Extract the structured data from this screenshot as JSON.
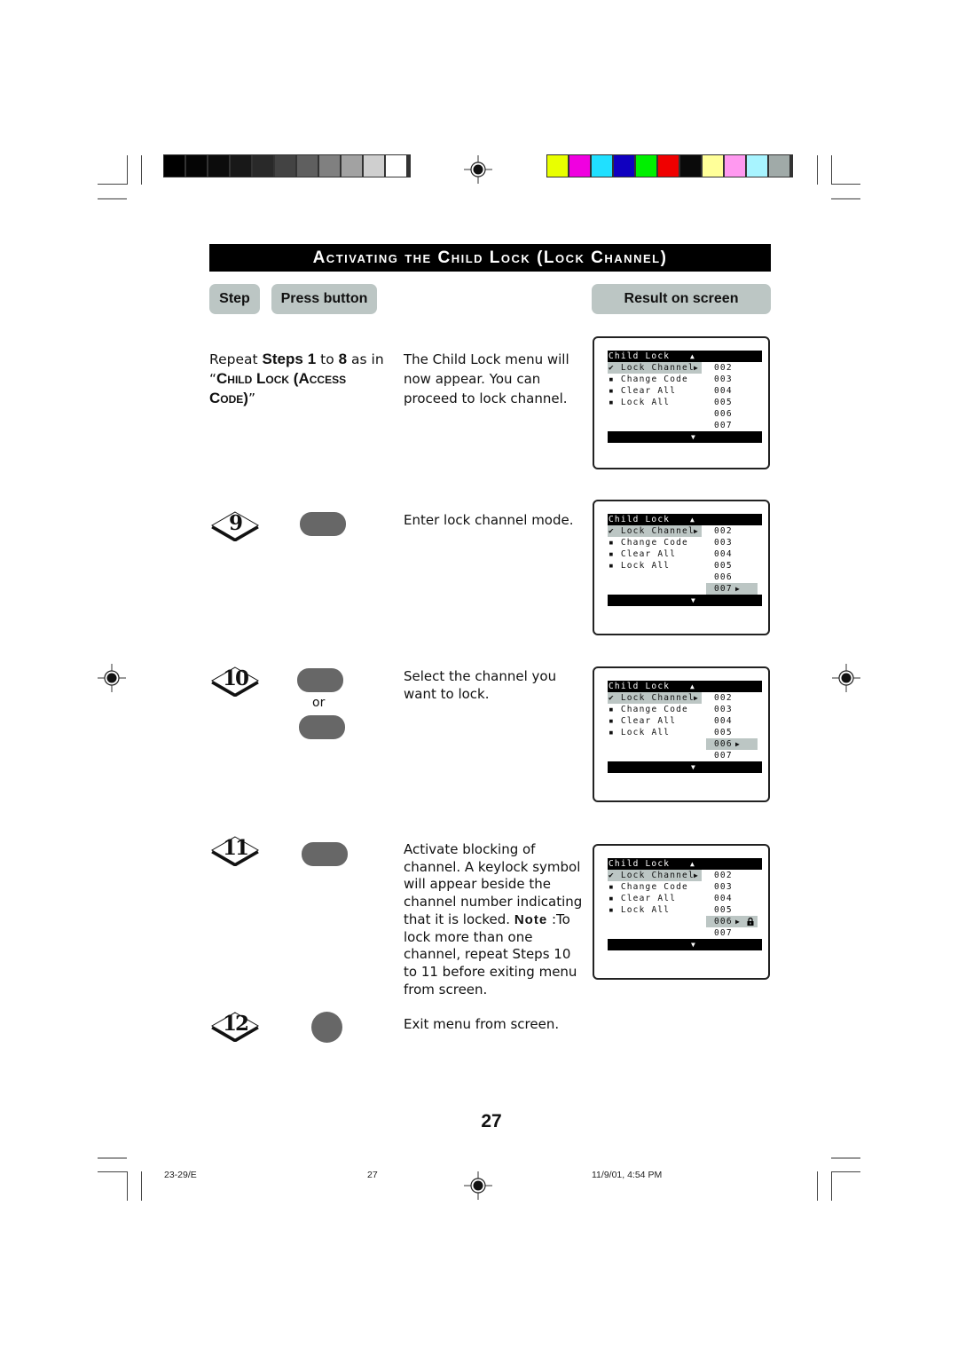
{
  "color_bars": {
    "grayscale": [
      "#000000",
      "#050505",
      "#0c0c0c",
      "#181818",
      "#292929",
      "#434343",
      "#5f5f5f",
      "#808080",
      "#a2a2a2",
      "#cfcfcf",
      "#ffffff"
    ],
    "colors": [
      "#e9ff00",
      "#f000e0",
      "#20e0ff",
      "#1000c0",
      "#00f000",
      "#f00000",
      "#0a0a0a",
      "#ffff99",
      "#ff99f0",
      "#a8f4ff",
      "#a0aaa8"
    ]
  },
  "title": "Activating the Child Lock (Lock Channel)",
  "headers": {
    "step": "Step",
    "press_button": "Press button",
    "result": "Result on screen"
  },
  "intro": {
    "pre": "Repeat ",
    "steps_label": "Steps",
    "from": "1",
    "to_word": " to ",
    "to": "8",
    "as": " as in “",
    "ref_title": "Child Lock (Access Code)",
    "close": "”",
    "result": "The Child Lock menu will now appear. You can proceed to lock channel."
  },
  "osd": {
    "header": "Child Lock",
    "menu_items": [
      {
        "label": "Lock Channel",
        "marker": "✔",
        "selected": true
      },
      {
        "label": "Change Code",
        "marker": "▪"
      },
      {
        "label": "Clear All",
        "marker": "▪"
      },
      {
        "label": "Lock All",
        "marker": "▪"
      }
    ],
    "channels": [
      "002",
      "003",
      "004",
      "005",
      "006",
      "007"
    ],
    "up_arrow": "▲",
    "down_arrow": "▼",
    "right_arrow": "▶"
  },
  "screens": [
    {
      "highlighted_channel": null,
      "locked": null
    },
    {
      "highlighted_channel": "007",
      "locked": null
    },
    {
      "highlighted_channel": "006",
      "locked": null
    },
    {
      "highlighted_channel": "006",
      "locked": "006"
    }
  ],
  "steps": [
    {
      "number": "9",
      "buttons": 1,
      "button_shape": "pill",
      "description": "Enter lock channel mode."
    },
    {
      "number": "10",
      "buttons": 2,
      "button_shape": "pill",
      "or_label": "or",
      "description": "Select the channel you want to lock."
    },
    {
      "number": "11",
      "buttons": 1,
      "button_shape": "pill",
      "description": "Activate blocking of channel. A keylock symbol will appear beside the channel number indicating that it is locked.",
      "note_label": "Note",
      "note_text": " :To lock more than one channel, repeat Steps 10 to 11 before exiting menu from screen."
    },
    {
      "number": "12",
      "buttons": 1,
      "button_shape": "round",
      "description": "Exit menu from screen."
    }
  ],
  "page_number": "27",
  "footer": {
    "doc_code": "23-29/E",
    "page": "27",
    "timestamp": "11/9/01, 4:54 PM"
  }
}
